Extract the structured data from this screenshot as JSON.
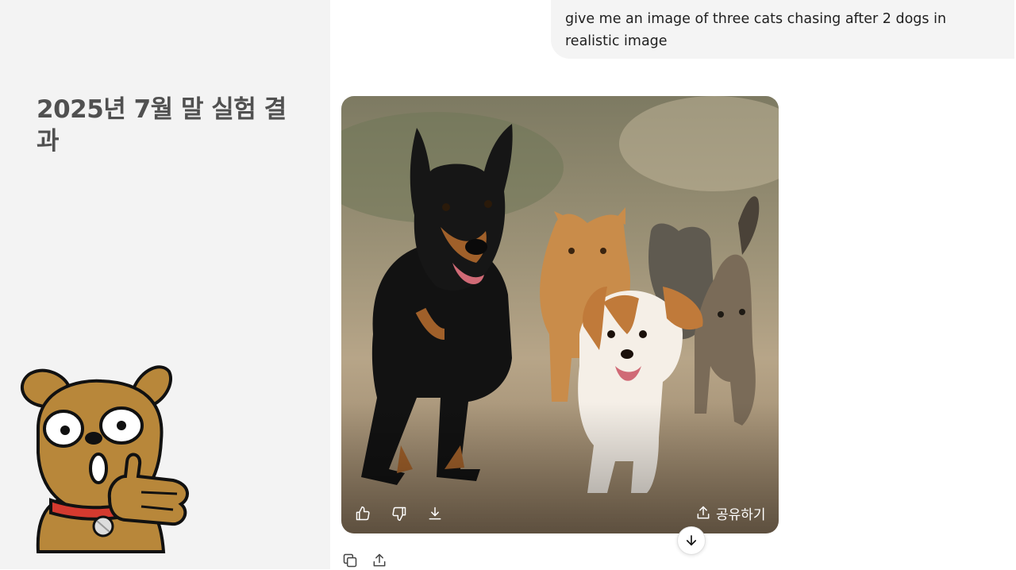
{
  "slide": {
    "title": "2025년 7월 말 실험 결과"
  },
  "chat": {
    "user_message": "give me an image of three cats chasing after 2 dogs in realistic image",
    "image_toolbar": {
      "like_icon": "thumbs-up-icon",
      "dislike_icon": "thumbs-down-icon",
      "download_icon": "download-icon",
      "share_label": "공유하기",
      "share_icon": "share-icon"
    },
    "message_actions": [
      "copy-icon",
      "share-icon"
    ],
    "scroll_icon": "arrow-down-icon"
  },
  "colors": {
    "sidebar_bg": "#f3f3f3",
    "bubble_bg": "#f4f4f4",
    "title_text": "#505050",
    "mascot_fur": "#b8873a",
    "mascot_collar": "#d43a2f"
  }
}
